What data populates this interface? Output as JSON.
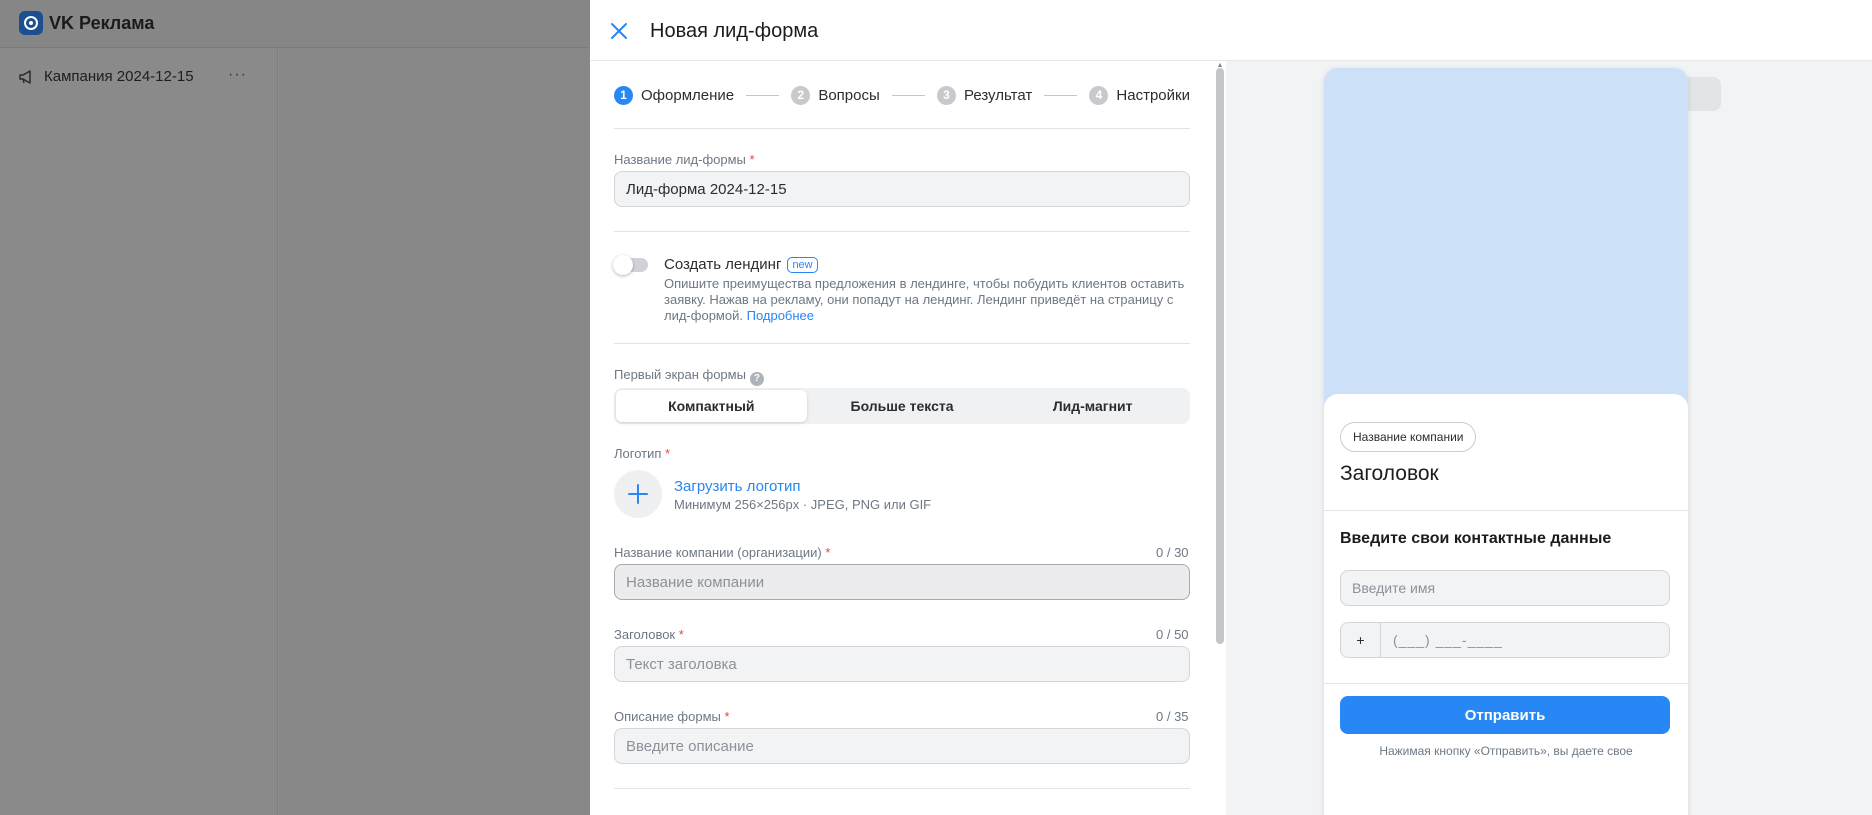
{
  "app": {
    "brand": "VK Реклама",
    "campaign": "Кампания 2024-12-15",
    "campaign_menu": "···"
  },
  "drawer": {
    "title": "Новая лид-форма"
  },
  "steps": [
    {
      "num": "1",
      "label": "Оформление",
      "active": true
    },
    {
      "num": "2",
      "label": "Вопросы",
      "active": false
    },
    {
      "num": "3",
      "label": "Результат",
      "active": false
    },
    {
      "num": "4",
      "label": "Настройки",
      "active": false
    }
  ],
  "form": {
    "name_label": "Название лид-формы",
    "name_value": "Лид-форма 2024-12-15",
    "required_mark": "*",
    "landing_title": "Создать лендинг",
    "landing_badge": "new",
    "landing_desc": "Опишите преимущества предложения в лендинге, чтобы побудить клиентов оставить заявку. Нажав на рекламу, они попадут на лендинг. Лендинг приведёт на страницу с лид-формой.",
    "landing_link": "Подробнее",
    "first_screen_label": "Первый экран формы",
    "help_glyph": "?",
    "first_screen_options": [
      "Компактный",
      "Больше текста",
      "Лид-магнит"
    ],
    "logo_label": "Логотип",
    "logo_upload": "Загрузить логотип",
    "logo_hint": "Минимум 256×256px · JPEG, PNG или GIF",
    "company_label": "Название компании (организации)",
    "company_counter": "0 / 30",
    "company_placeholder": "Название компании",
    "headline_label": "Заголовок",
    "headline_counter": "0 / 50",
    "headline_placeholder": "Текст заголовка",
    "desc_label": "Описание формы",
    "desc_counter": "0 / 35",
    "desc_placeholder": "Введите описание"
  },
  "preview": {
    "theme_buttons": [
      "sun-icon",
      "moon-icon"
    ],
    "device_buttons": [
      "phone-icon",
      "desktop-icon"
    ],
    "company_chip": "Название компании",
    "headline": "Заголовок",
    "contact_title": "Введите свои контактные данные",
    "name_placeholder": "Введите имя",
    "phone_prefix": "+",
    "phone_mask": "(___) ___-____",
    "submit": "Отправить",
    "footer": "Нажимая кнопку «Отправить», вы даете свое"
  },
  "colors": {
    "accent": "#2787f5",
    "cover": "#cce0f8",
    "overlay": "#8e8e8e"
  }
}
